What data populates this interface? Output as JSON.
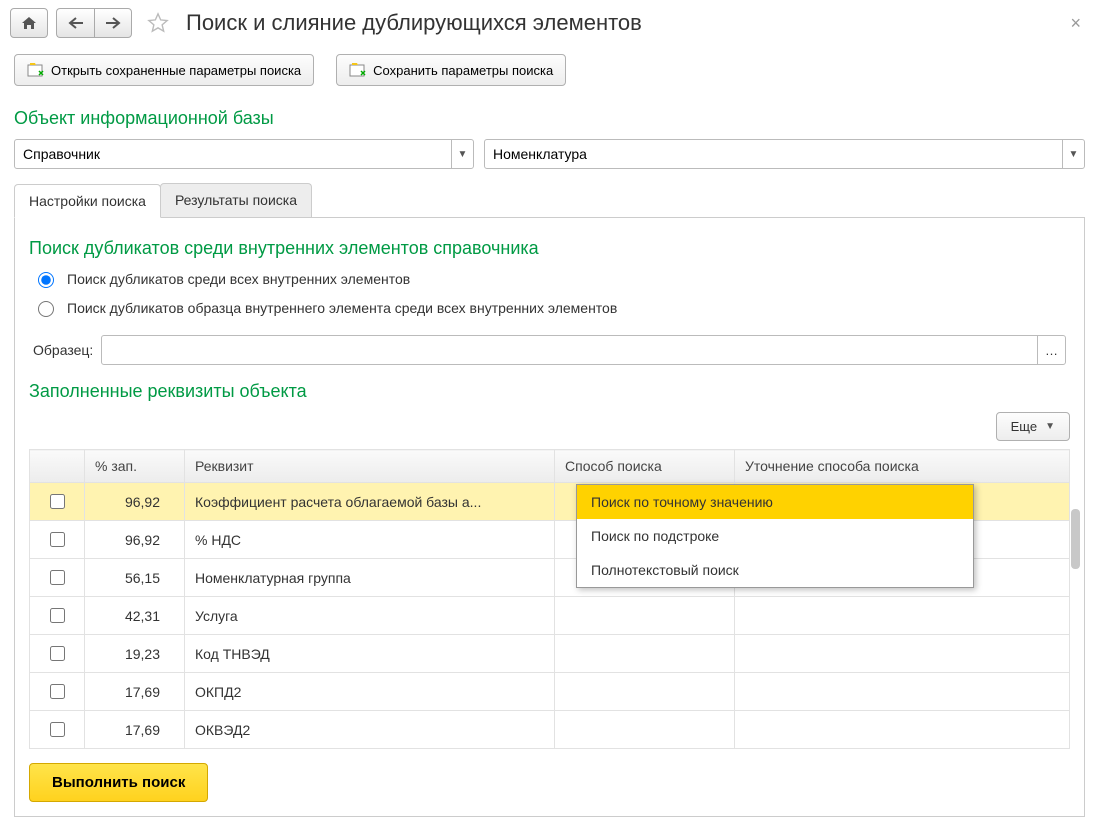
{
  "header": {
    "title": "Поиск и слияние дублирующихся элементов"
  },
  "buttons": {
    "open_params": "Открыть сохраненные параметры поиска",
    "save_params": "Сохранить параметры поиска",
    "more": "Еще",
    "run": "Выполнить поиск"
  },
  "sections": {
    "object": "Объект информационной базы",
    "search_inner": "Поиск дубликатов среди внутренних элементов справочника",
    "filled_req": "Заполненные реквизиты объекта"
  },
  "combos": {
    "type": "Справочник",
    "ref": "Номенклатура",
    "sample_label": "Образец:",
    "sample_value": ""
  },
  "tabs": {
    "settings": "Настройки поиска",
    "results": "Результаты поиска"
  },
  "radios": {
    "all": "Поиск дубликатов среди всех внутренних элементов",
    "sample": "Поиск дубликатов образца внутреннего элемента среди всех внутренних элементов"
  },
  "grid": {
    "headers": {
      "check": "",
      "pct": "% зап.",
      "req": "Реквизит",
      "method": "Способ поиска",
      "detail": "Уточнение способа поиска"
    },
    "rows": [
      {
        "pct": "96,92",
        "req": "Коэффициент расчета облагаемой базы а...",
        "hl": true
      },
      {
        "pct": "96,92",
        "req": "% НДС"
      },
      {
        "pct": "56,15",
        "req": "Номенклатурная группа"
      },
      {
        "pct": "42,31",
        "req": "Услуга"
      },
      {
        "pct": "19,23",
        "req": "Код ТНВЭД"
      },
      {
        "pct": "17,69",
        "req": "ОКПД2"
      },
      {
        "pct": "17,69",
        "req": "ОКВЭД2"
      }
    ]
  },
  "dropdown": {
    "opt1": "Поиск по точному значению",
    "opt2": "Поиск по подстроке",
    "opt3": "Полнотекстовый поиск"
  }
}
